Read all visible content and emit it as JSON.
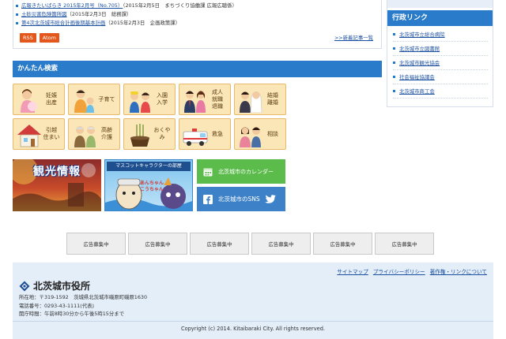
{
  "news": {
    "items": [
      {
        "title": "広報きたいばらき 2015年2月号（No.705）",
        "meta": "（2015年2月5日　まちづくり協働課 広報広聴係）"
      },
      {
        "title": "土砂災害危険箇所図",
        "meta": "（2015年2月3日　総務課）"
      },
      {
        "title": "第4次北茨城市総合計画後期基本計画",
        "meta": "（2015年2月3日　企画政策課）"
      }
    ],
    "rss_label": "RSS",
    "atom_label": "Atom",
    "more_label": ">>新着記事一覧"
  },
  "sidebar": {
    "title": "行政リンク",
    "links": [
      "北茨城市立総合病院",
      "北茨城市立図書館",
      "北茨城市観光協会",
      "社会福祉協議会",
      "北茨城市商工会"
    ]
  },
  "search": {
    "title": "かんたん検索",
    "tiles": [
      {
        "label": "妊娠\n出産",
        "icon": "pregnancy-icon"
      },
      {
        "label": "子育て",
        "icon": "childcare-icon"
      },
      {
        "label": "入園\n入学",
        "icon": "school-entry-icon"
      },
      {
        "label": "成人\n就職\n退職",
        "icon": "employment-icon"
      },
      {
        "label": "結婚\n離婚",
        "icon": "marriage-icon"
      },
      {
        "label": "引越\n住まい",
        "icon": "house-icon"
      },
      {
        "label": "高齢\n介護",
        "icon": "elderly-care-icon"
      },
      {
        "label": "おくやみ",
        "icon": "condolence-icon"
      },
      {
        "label": "救急",
        "icon": "ambulance-icon"
      },
      {
        "label": "相談",
        "icon": "consultation-icon"
      }
    ]
  },
  "banners": {
    "kanko_text": "観光情報",
    "mascot_title": "マスコットキャラクターの部屋",
    "mascot_names": "あんちゃん　こうちゃん",
    "calendar_label": "北茨城市のカレンダー",
    "sns_label": "北茨城市のSNS"
  },
  "ads": [
    "広告募集中",
    "広告募集中",
    "広告募集中",
    "広告募集中",
    "広告募集中",
    "広告募集中"
  ],
  "footer": {
    "links": [
      "サイトマップ",
      "プライバシーポリシー",
      "著作権・リンクについて"
    ],
    "city_name": "北茨城市役所",
    "address": "所在地：〒319-1592　茨城県北茨城市磯原町磯原1630",
    "phone": "電話番号：0293-43-1111(代表)",
    "hours": "開庁時間：午前8時30分から午後5時15分まで",
    "copyright": "Copyright (c) 2014. Kitaibaraki City. All rights reserved."
  },
  "colors": {
    "accent_blue": "#2a7bc9",
    "feed_orange": "#e4571c",
    "tile_bg": "#fbe6b8",
    "calendar_green": "#5bbb4b",
    "footer_bg": "#e3eef9"
  }
}
